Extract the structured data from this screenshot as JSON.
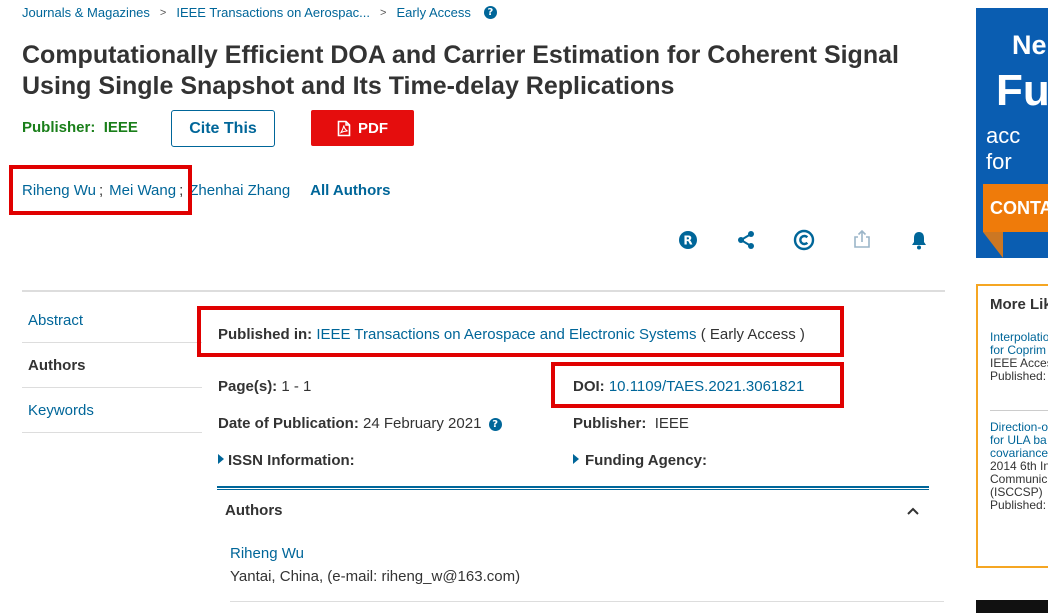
{
  "breadcrumb": {
    "items": [
      "Journals & Magazines",
      "IEEE Transactions on Aerospac...",
      "Early Access"
    ],
    "separator": ">"
  },
  "article": {
    "title": "Computationally Efficient DOA and Carrier Estimation for Coherent Signal Using Single Snapshot and Its Time-delay Replications",
    "publisher_label": "Publisher:",
    "publisher_value": "IEEE"
  },
  "buttons": {
    "cite": "Cite This",
    "pdf": "PDF"
  },
  "authors": {
    "names": [
      "Riheng Wu",
      "Mei Wang",
      "Zhenhai Zhang"
    ],
    "separator": ";",
    "all_authors": "All Authors"
  },
  "action_icons": [
    "r-badge-icon",
    "share-icon",
    "copyright-icon",
    "export-icon",
    "bell-icon"
  ],
  "sidebar": {
    "items": [
      {
        "label": "Abstract",
        "active": false
      },
      {
        "label": "Authors",
        "active": true
      },
      {
        "label": "Keywords",
        "active": false
      }
    ]
  },
  "metadata": {
    "published_in_label": "Published in:",
    "published_in_value": "IEEE Transactions on Aerospace and Electronic Systems",
    "published_in_status": "( Early Access )",
    "pages_label": "Page(s):",
    "pages_value": "1 - 1",
    "doi_label": "DOI:",
    "doi_value": "10.1109/TAES.2021.3061821",
    "date_label": "Date of Publication:",
    "date_value": "24 February 2021",
    "publisher_label": "Publisher:",
    "publisher_value": "IEEE",
    "issn_label": "ISSN Information:",
    "funding_label": "Funding Agency:"
  },
  "authors_section": {
    "heading": "Authors",
    "entries": [
      {
        "name": "Riheng Wu",
        "affiliation": "Yantai, China, (e-mail: riheng_w@163.com)"
      }
    ]
  },
  "ad": {
    "line1": "Ne",
    "line2": "Fu",
    "line3": "acc",
    "line4": "for",
    "cta": "CONTA"
  },
  "more_like_this": {
    "heading": "More Lik",
    "items": [
      {
        "title_lines": [
          "Interpolatio",
          "for Coprim"
        ],
        "source_lines": [
          "IEEE Acces"
        ],
        "published": "Published:"
      },
      {
        "title_lines": [
          "Direction-o",
          "for ULA ba",
          "covariance"
        ],
        "source_lines": [
          "2014 6th In",
          "Communic",
          "(ISCCSP)"
        ],
        "published": "Published:"
      }
    ]
  },
  "colors": {
    "link": "#006699",
    "pdf_red": "#e50d0d",
    "annotation_red": "#e00000",
    "publisher_green": "#1a7f1a",
    "ad_blue": "#0a5db1",
    "ad_orange": "#ef7b0a",
    "panel_border": "#f5a623"
  }
}
